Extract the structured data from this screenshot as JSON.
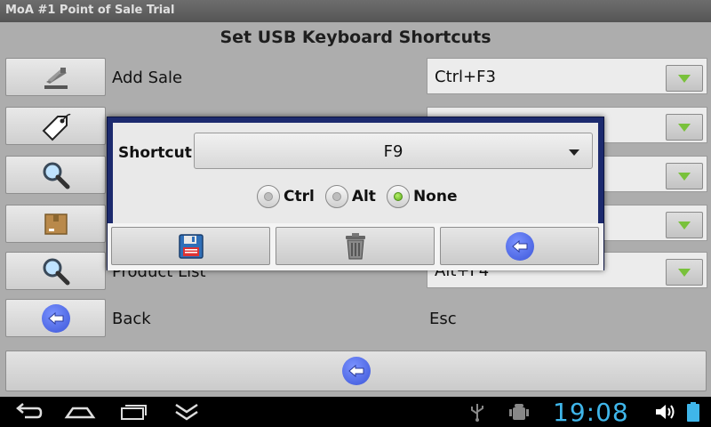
{
  "window": {
    "title": "MoA #1 Point of Sale Trial"
  },
  "page": {
    "heading": "Set USB Keyboard Shortcuts"
  },
  "rows": [
    {
      "icon": "stapler-icon",
      "label": "Add Sale",
      "value": "Ctrl+F3",
      "has_dropdown": true
    },
    {
      "icon": "price-tag-icon",
      "label": "",
      "value": "",
      "has_dropdown": true
    },
    {
      "icon": "magnifier-icon",
      "label": "",
      "value": "",
      "has_dropdown": true
    },
    {
      "icon": "box-icon",
      "label": "",
      "value": "",
      "has_dropdown": true
    },
    {
      "icon": "magnifier-icon",
      "label": "Product List",
      "value": "Alt+F4",
      "has_dropdown": true
    },
    {
      "icon": "back-arrow-icon",
      "label": "Back",
      "value": "Esc",
      "has_dropdown": false
    }
  ],
  "dialog": {
    "shortcut_label": "Shortcut",
    "shortcut_value": "F9",
    "modifiers": [
      {
        "label": "Ctrl",
        "selected": false
      },
      {
        "label": "Alt",
        "selected": false
      },
      {
        "label": "None",
        "selected": true
      }
    ],
    "actions": [
      "save-floppy-icon",
      "trash-can-icon",
      "back-arrow-icon"
    ]
  },
  "status_bar": {
    "time": "19:08"
  },
  "colors": {
    "dialog_border": "#1c2a6e",
    "accent_green": "#79c13b",
    "clock": "#3fb6ea",
    "back_blue": "#3c56d8"
  }
}
